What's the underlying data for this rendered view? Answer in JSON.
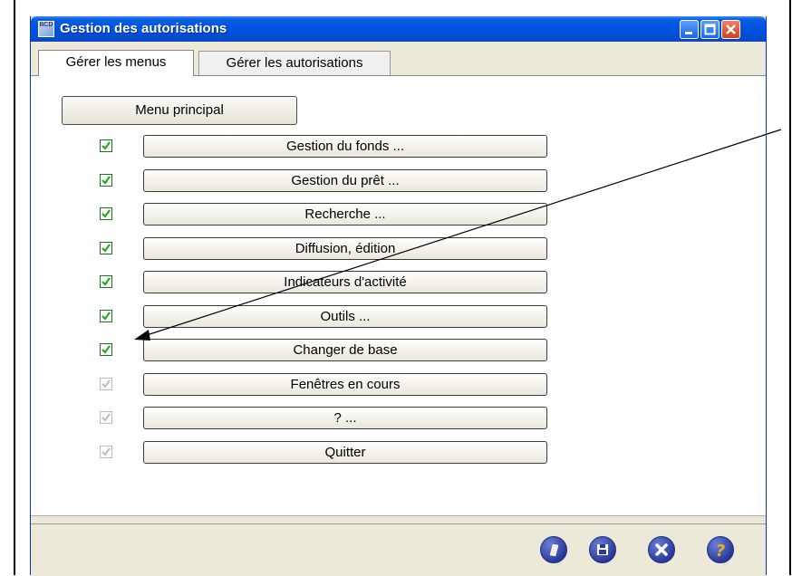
{
  "window": {
    "title": "Gestion des autorisations",
    "app_icon_text": "BCD"
  },
  "tabs": [
    {
      "label": "Gérer les menus",
      "active": true
    },
    {
      "label": "Gérer les autorisations",
      "active": false
    }
  ],
  "main_menu_button": "Menu principal",
  "menu_items": [
    {
      "label": "Gestion du fonds  ...",
      "checked": true,
      "enabled": true
    },
    {
      "label": "Gestion du prêt  ...",
      "checked": true,
      "enabled": true
    },
    {
      "label": "Recherche  ...",
      "checked": true,
      "enabled": true
    },
    {
      "label": "Diffusion, édition",
      "checked": true,
      "enabled": true
    },
    {
      "label": "Indicateurs d'activité",
      "checked": true,
      "enabled": true
    },
    {
      "label": "Outils  ...",
      "checked": true,
      "enabled": true
    },
    {
      "label": "Changer de base",
      "checked": true,
      "enabled": true
    },
    {
      "label": "Fenêtres en cours",
      "checked": true,
      "enabled": false
    },
    {
      "label": "?  ...",
      "checked": true,
      "enabled": false
    },
    {
      "label": "Quitter",
      "checked": true,
      "enabled": false
    }
  ],
  "toolbar_icons": [
    "clear-icon",
    "save-icon",
    "cancel-icon",
    "help-icon"
  ],
  "colors": {
    "titlebar": "#0053e1",
    "check": "#21a121",
    "check_disabled": "#bdbdbd"
  }
}
